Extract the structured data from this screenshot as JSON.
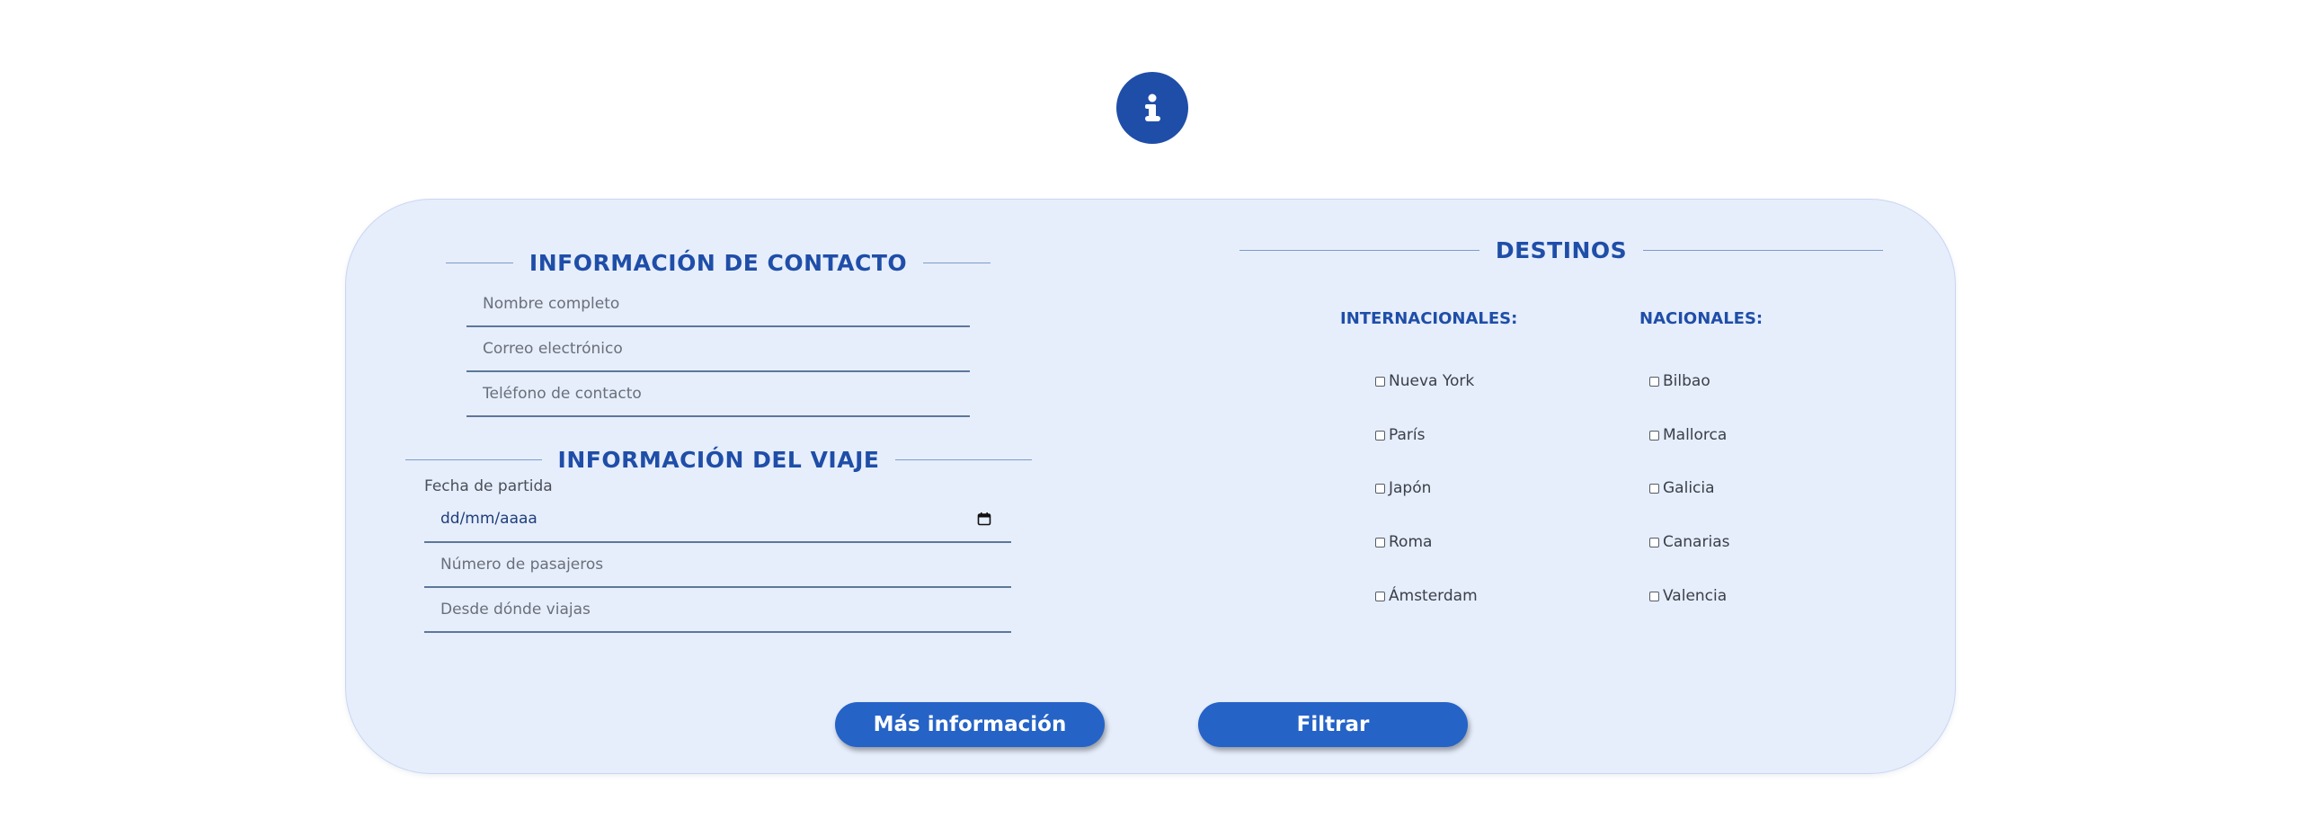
{
  "header": {
    "icon": "info-icon",
    "icon_color": "#1f4ea8"
  },
  "contact": {
    "title": "INFORMACIÓN DE CONTACTO",
    "name_placeholder": "Nombre completo",
    "email_placeholder": "Correo electrónico",
    "phone_placeholder": "Teléfono de contacto"
  },
  "trip": {
    "title": "INFORMACIÓN DEL VIAJE",
    "date_label": "Fecha de partida",
    "date_value": "dd/mm/aaaa",
    "passengers_placeholder": "Número de pasajeros",
    "origin_placeholder": "Desde dónde viajas"
  },
  "destinations": {
    "title": "DESTINOS",
    "international": {
      "heading": "INTERNACIONALES:",
      "items": [
        "Nueva York",
        "París",
        "Japón",
        "Roma",
        "Ámsterdam"
      ]
    },
    "national": {
      "heading": "NACIONALES:",
      "items": [
        "Bilbao",
        "Mallorca",
        "Galicia",
        "Canarias",
        "Valencia"
      ]
    }
  },
  "actions": {
    "more_info_label": "Más información",
    "filter_label": "Filtrar"
  },
  "colors": {
    "accent": "#1f4ea8",
    "button": "#2563c7",
    "card_background": "#e6eefc"
  }
}
